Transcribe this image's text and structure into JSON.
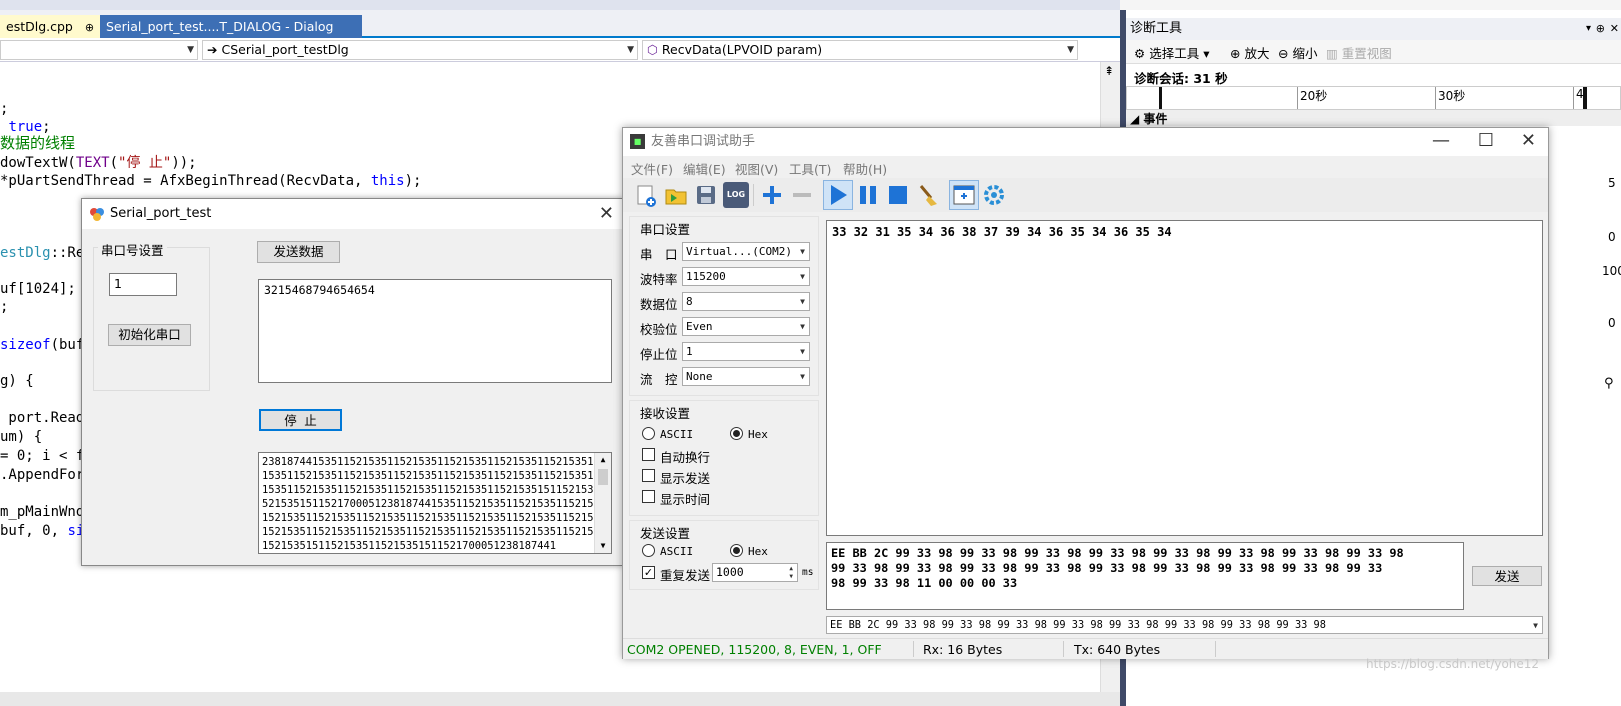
{
  "ide": {
    "tabs": {
      "active": "estDlg.cpp",
      "active_pin": "⊕",
      "dialog": "Serial_port_test....T_DIALOG - Dialog"
    },
    "nav": {
      "scope": "",
      "class": "CSerial_port_testDlg",
      "method": "RecvData(LPVOID param)"
    },
    "code": {
      "l1": ";",
      "l2a": " ",
      "l2kw": "true",
      "l2b": ";",
      "l3": "数据的线程",
      "l4a": "dowTextW(",
      "l4mac": "TEXT",
      "l4b": "(",
      "l4str": "\"停 止\"",
      "l4c": "));",
      "l5a": "*pUartSendThread = AfxBeginThread(RecvData, ",
      "l5kw": "this",
      "l5b": ");",
      "l6cls": "estDlg",
      "l6b": "::Rec",
      "l7": "uf[1024];",
      "l8": ";",
      "l9kw": "sizeof",
      "l9b": "(buf)",
      "l10": "g) {",
      "l11": " port.Read",
      "l12": "um) {",
      "l13": "= 0; i < fr",
      "l14": ".AppendForm",
      "l15": "m_pMainWnd-",
      "l16a": "buf, 0, ",
      "l16kw": "si"
    }
  },
  "diag": {
    "title": "诊断工具",
    "pin": "⊕",
    "close": "✕",
    "select_tool": "选择工具",
    "zoom_in": "放大",
    "zoom_out": "缩小",
    "reset_view": "重置视图",
    "session": "诊断会话: 31 秒",
    "tick_20": "20秒",
    "tick_30": "30秒",
    "tick_4": "4",
    "events": "事件",
    "side_5": "5",
    "side_0a": "0",
    "side_100": "100",
    "side_0b": "0"
  },
  "spt": {
    "title": "Serial_port_test",
    "group_label": "串口号设置",
    "port_value": "1",
    "init_button": "初始化串口",
    "send_button": "发送数据",
    "send_text": "3215468794654654",
    "stop_button": "停 止",
    "log_lines": [
      "23818744153511521535115215351152153511521535115215351152",
      "15351152153511521535115215351152153511521535115215351152",
      "15351152153511521535115215351152153511521535151152153511",
      "52153515115217000512381874415351152153511521535115215351",
      "15215351152153511521535115215351152153511521535115215351",
      "15215351152153511521535115215351152153511521535115215351",
      "15215351511521535115215351511521700051238187441"
    ]
  },
  "sa": {
    "title": "友善串口调试助手",
    "menu": [
      "文件(F)",
      "编辑(E)",
      "视图(V)",
      "工具(T)",
      "帮助(H)"
    ],
    "toolbar_log": "LOG",
    "serial_settings": "串口设置",
    "port_label": "串　口",
    "port_value": "Virtual...(COM2)",
    "baud_label": "波特率",
    "baud_value": "115200",
    "databits_label": "数据位",
    "databits_value": "8",
    "parity_label": "校验位",
    "parity_value": "Even",
    "stopbits_label": "停止位",
    "stopbits_value": "1",
    "flow_label": "流　控",
    "flow_value": "None",
    "recv_settings": "接收设置",
    "recv_ascii": "ASCII",
    "recv_hex": "Hex",
    "auto_wrap": "自动换行",
    "show_send": "显示发送",
    "show_time": "显示时间",
    "send_settings": "发送设置",
    "send_ascii": "ASCII",
    "send_hex": "Hex",
    "repeat_send": "重复发送",
    "repeat_checkmark": "✓",
    "repeat_ms": "1000",
    "ms_unit": "ms",
    "recv_data": "33 32 31 35 34 36 38 37 39 34 36 35 34 36 35 34",
    "send_line1": "EE BB 2C 99 33 98 99 33 98 99 33 98 99 33 98 99 33 98 99 33 98 99 33 98 99 33 98",
    "send_line2": "99 33 98 99 33 98 99 33 98 99 33 98 99 33 98 99 33 98 99 33 98 99 33 98 99 33",
    "send_line3": "98 99 33 98 11 00 00 00 33",
    "send_button": "发送",
    "history": "EE BB 2C 99 33 98 99 33 98 99 33 98 99 33 98 99 33 98 99 33 98 99 33 98 99 33 98",
    "status_port": "COM2 OPENED, 115200, 8, EVEN, 1, OFF",
    "status_rx": "Rx: 16 Bytes",
    "status_tx": "Tx: 640 Bytes",
    "watermark": "https://blog.csdn.net/yohe12"
  },
  "colors": {
    "accent": "#007acc",
    "status_green": "#008000",
    "tab_active": "#fffacd",
    "tab_dialog": "#3d6fb5"
  }
}
